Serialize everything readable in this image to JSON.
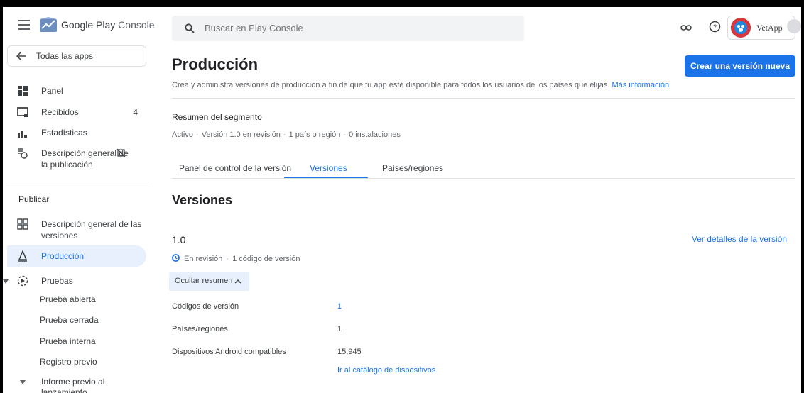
{
  "header": {
    "brand": "Google Play",
    "brand_suffix": "Console",
    "search_placeholder": "Buscar en Play Console",
    "app_name": "VetApp"
  },
  "sidebar": {
    "back_label": "Todas las apps",
    "items": [
      {
        "label": "Panel",
        "icon": "dashboard-icon"
      },
      {
        "label": "Recibidos",
        "badge": "4",
        "icon": "inbox-icon"
      },
      {
        "label": "Estadísticas",
        "icon": "bar-chart-icon"
      },
      {
        "label": "Descripción general de",
        "label2": "la publicación",
        "icon": "publishing-overview-icon"
      }
    ],
    "publish_section": "Publicar",
    "publish_items": [
      {
        "label": "Descripción general de las",
        "label2": "versiones",
        "icon": "releases-overview-icon"
      },
      {
        "label": "Producción",
        "icon": "production-icon"
      },
      {
        "label": "Pruebas",
        "icon": "testing-icon"
      }
    ],
    "testing_subitems": [
      "Prueba abierta",
      "Prueba cerrada",
      "Prueba interna",
      "Registro previo"
    ],
    "prelaunch_label": "Informe previo al",
    "prelaunch_label2": "lanzamiento"
  },
  "main": {
    "title": "Producción",
    "create_button": "Crear una versión nueva",
    "description": "Crea y administra versiones de producción a fin de que tu app esté disponible para todos los usuarios de los países que elijas.",
    "more_info": "Más información",
    "segment_title": "Resumen del segmento",
    "segment_meta": [
      "Activo",
      "Versión 1.0 en revisión",
      "1 país o región",
      "0 instalaciones"
    ],
    "tabs": [
      "Panel de control de la versión",
      "Versiones",
      "Países/regiones"
    ],
    "active_tab": "Versiones",
    "section_title": "Versiones",
    "version_number": "1.0",
    "version_details_link": "Ver detalles de la versión",
    "version_status": "En revisión",
    "version_code_count": "1 código de versión",
    "hide_summary": "Ocultar resumen",
    "details": [
      {
        "label": "Códigos de versión",
        "value": "1"
      },
      {
        "label": "Países/regiones",
        "value": "1"
      },
      {
        "label": "Dispositivos Android compatibles",
        "value": "15,945"
      }
    ],
    "device_catalog_link": "Ir al catálogo de dispositivos"
  },
  "colors": {
    "accent": "#1a73e8",
    "active_bg": "#e8f0fe"
  }
}
